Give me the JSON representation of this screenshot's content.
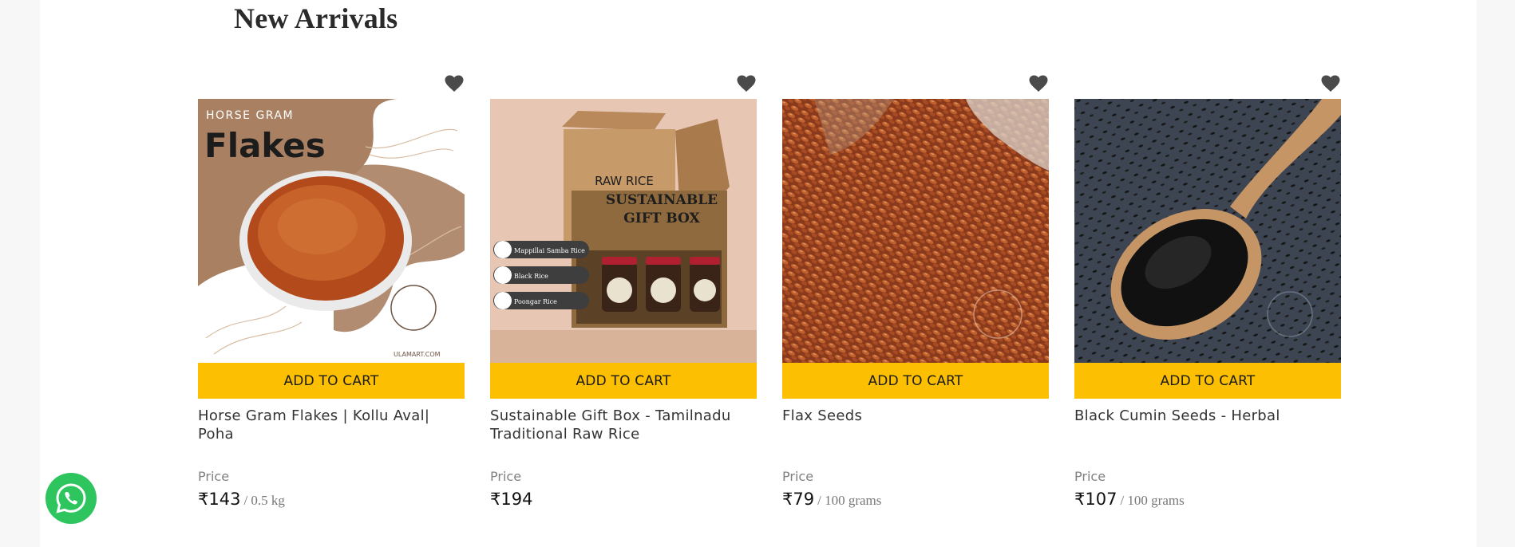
{
  "section": {
    "title": "New Arrivals"
  },
  "products": [
    {
      "name": "Horse Gram Flakes | Kollu Aval| Poha",
      "add_to_cart_label": "ADD TO CART",
      "price_label": "Price",
      "price": "₹143",
      "unit": "/ 0.5 kg",
      "image_text": {
        "top": "HORSE GRAM",
        "main": "Flakes",
        "footer": "ULAMART.COM"
      }
    },
    {
      "name": "Sustainable Gift Box - Tamilnadu Traditional Raw Rice",
      "add_to_cart_label": "ADD TO CART",
      "price_label": "Price",
      "price": "₹194",
      "unit": "",
      "image_text": {
        "line1": "RAW RICE",
        "line2": "SUSTAINABLE",
        "line3": "GIFT BOX",
        "items": [
          "Mappillai Samba Rice",
          "Black Rice",
          "Poongar Rice"
        ]
      }
    },
    {
      "name": "Flax Seeds",
      "add_to_cart_label": "ADD TO CART",
      "price_label": "Price",
      "price": "₹79",
      "unit": "/ 100 grams",
      "image_text": {}
    },
    {
      "name": "Black Cumin Seeds - Herbal",
      "add_to_cart_label": "ADD TO CART",
      "price_label": "Price",
      "price": "₹107",
      "unit": "/ 100 grams",
      "image_text": {}
    }
  ],
  "icons": {
    "wishlist": "heart-icon",
    "chat": "whatsapp-icon"
  },
  "colors": {
    "accent": "#fcbf01",
    "whatsapp": "#2ec55f",
    "heart": "#4a4a4a"
  }
}
